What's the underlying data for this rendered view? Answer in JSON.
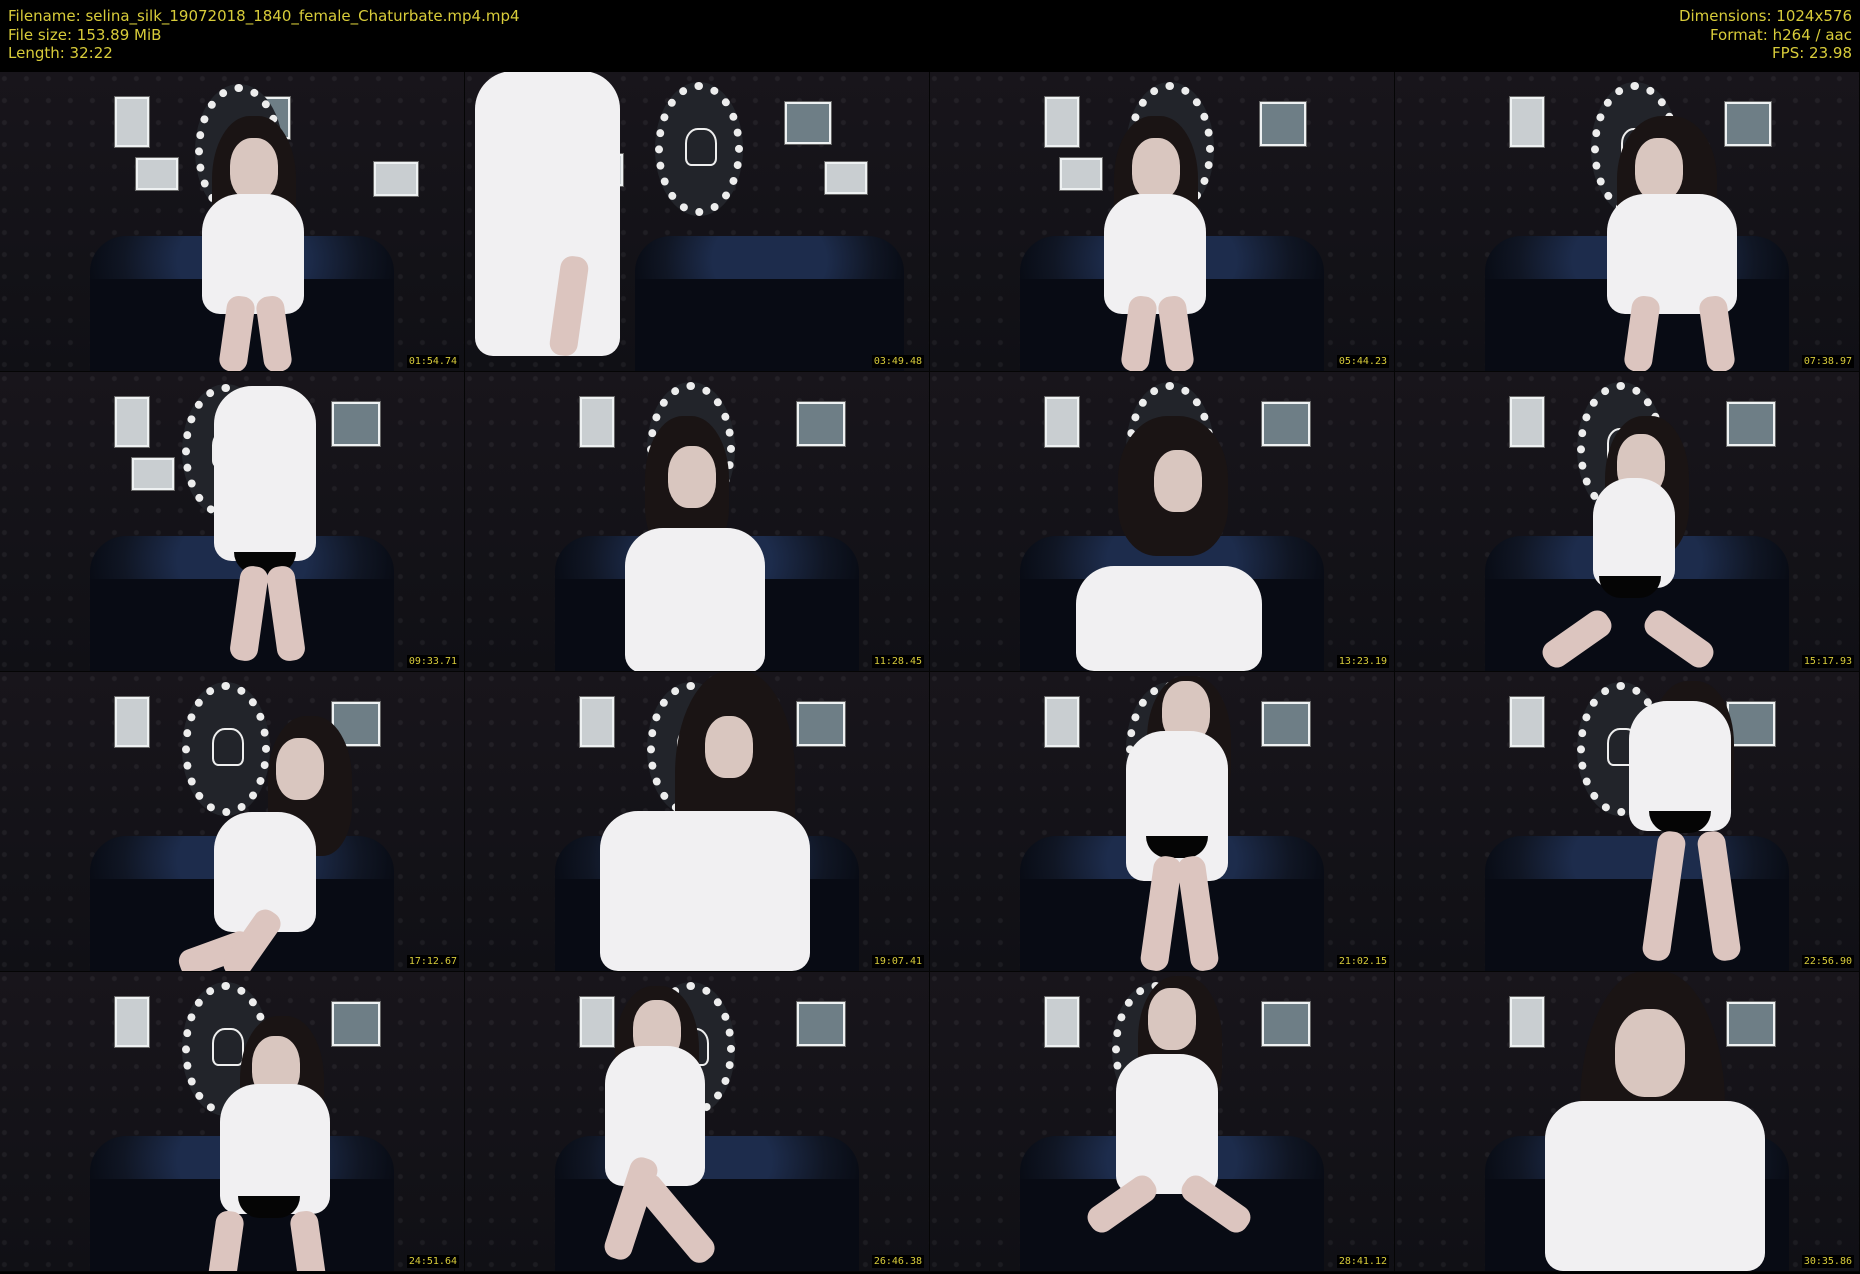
{
  "header": {
    "filename": "Filename: selina_silk_19072018_1840_female_Chaturbate.mp4.mp4",
    "file_size": "File size: 153.89 MiB",
    "length": "Length: 32:22",
    "dimensions": "Dimensions: 1024x576",
    "format": "Format: h264 / aac",
    "fps": "FPS: 23.98"
  },
  "thumbnails": [
    {
      "time": "01:54.74"
    },
    {
      "time": "03:49.48"
    },
    {
      "time": "05:44.23"
    },
    {
      "time": "07:38.97"
    },
    {
      "time": "09:33.71"
    },
    {
      "time": "11:28.45"
    },
    {
      "time": "13:23.19"
    },
    {
      "time": "15:17.93"
    },
    {
      "time": "17:12.67"
    },
    {
      "time": "19:07.41"
    },
    {
      "time": "21:02.15"
    },
    {
      "time": "22:56.90"
    },
    {
      "time": "24:51.64"
    },
    {
      "time": "26:46.38"
    },
    {
      "time": "28:41.12"
    },
    {
      "time": "30:35.86"
    }
  ],
  "colors": {
    "header_text": "#d8cc3a",
    "background": "#000000"
  }
}
